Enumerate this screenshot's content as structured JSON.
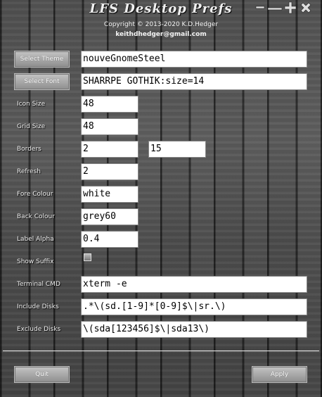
{
  "window": {
    "title": "LFS Desktop Prefs"
  },
  "header": {
    "copyright": "Copyright © 2013-2020 K.D.Hedger",
    "email": "keithdhedger@gmail.com"
  },
  "buttons": {
    "select_theme": "Select Theme",
    "select_font": "Select Font",
    "quit": "Quit",
    "apply": "Apply"
  },
  "fields": {
    "theme": "nouveGnomeSteel",
    "font": "SHARRPE GOTHIK:size=14",
    "icon_size": {
      "label": "Icon Size",
      "value": "48"
    },
    "grid_size": {
      "label": "Grid Size",
      "value": "48"
    },
    "borders": {
      "label": "Borders",
      "value1": "2",
      "value2": "15"
    },
    "refresh": {
      "label": "Refresh",
      "value": "2"
    },
    "fore_colour": {
      "label": "Fore Colour",
      "value": "white"
    },
    "back_colour": {
      "label": "Back Colour",
      "value": "grey60"
    },
    "label_alpha": {
      "label": "Label Alpha",
      "value": "0.4"
    },
    "show_suffix": {
      "label": "Show Suffix",
      "checked": false
    },
    "terminal_cmd": {
      "label": "Terminal CMD",
      "value": "xterm -e"
    },
    "include_disks": {
      "label": "Include Disks",
      "value": ".*\\(sd.[1-9]*[0-9]$\\|sr.\\)"
    },
    "exclude_disks": {
      "label": "Exclude Disks",
      "value": "\\(sda[123456]$\\|sda13\\)"
    }
  },
  "icons": [
    "minimize-icon",
    "shade-icon",
    "maximize-icon",
    "close-icon"
  ]
}
